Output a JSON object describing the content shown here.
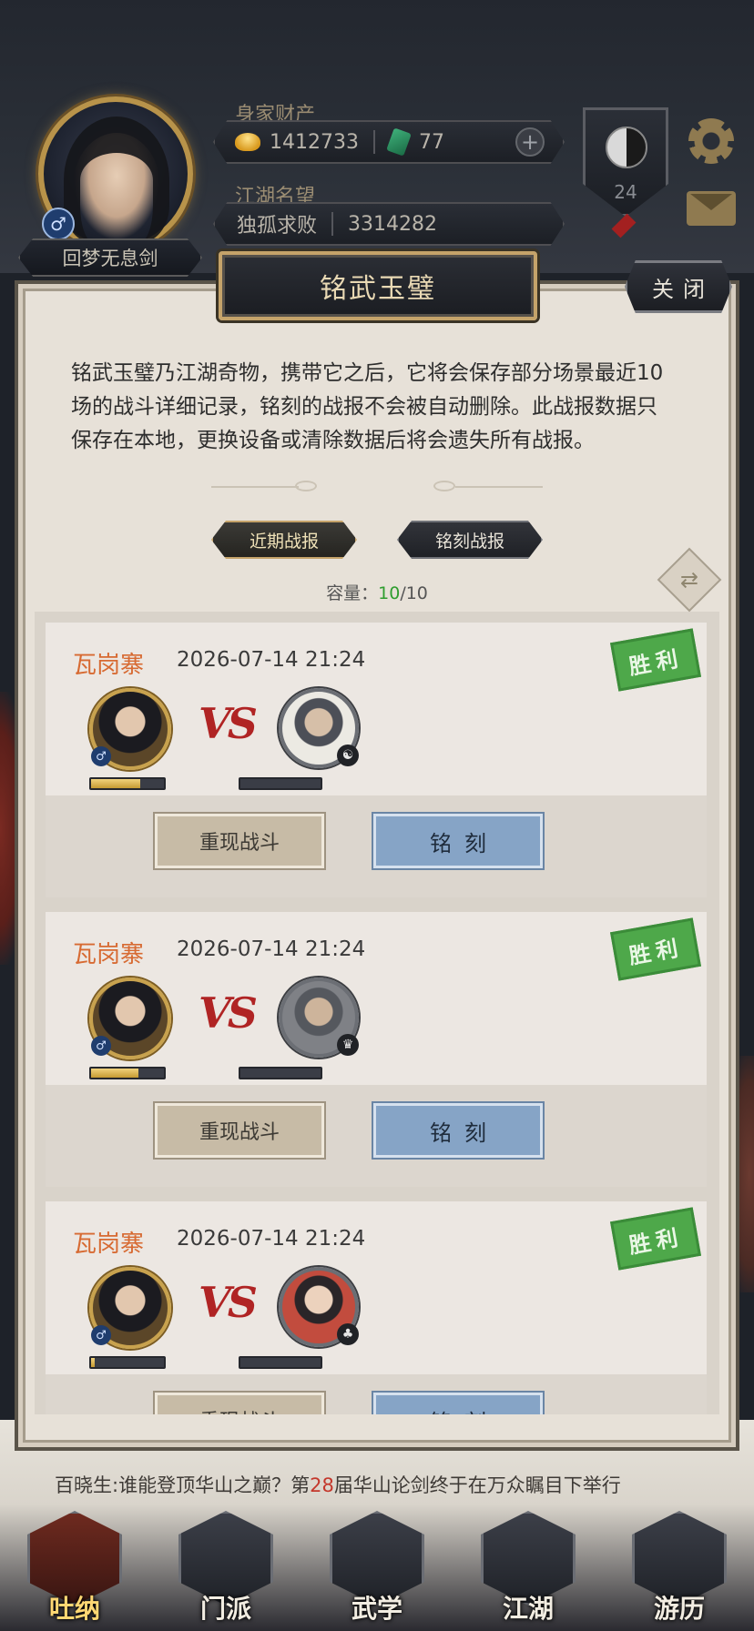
{
  "header": {
    "player_name": "回梦无息剑",
    "gender_symbol": "♂",
    "wealth_label": "身家财产",
    "gold": "1412733",
    "jade": "77",
    "plus": "+",
    "fame_label": "江湖名望",
    "fame_title": "独孤求败",
    "fame_value": "3314282",
    "level_badge": "24"
  },
  "panel": {
    "title": "铭武玉璧",
    "close_label": "关闭",
    "intro": "铭武玉璧乃江湖奇物，携带它之后，它将会保存部分场景最近10场的战斗详细记录，铭刻的战报不会被自动删除。此战报数据只保存在本地，更换设备或清除数据后将会遗失所有战报。",
    "tabs": [
      {
        "label": "近期战报",
        "active": true
      },
      {
        "label": "铭刻战报",
        "active": false
      }
    ],
    "capacity_label": "容量：",
    "capacity_used": "10",
    "capacity_total": "/10"
  },
  "records": [
    {
      "location": "瓦岗寨",
      "time": "2026-07-14 21:24",
      "result": "胜利",
      "vs": "VS",
      "player_hp_fraction": 0.68,
      "enemy_hp_fraction": 0,
      "enemy_sect_icon": "☯",
      "replay_label": "重现战斗",
      "engrave_label": "铭刻"
    },
    {
      "location": "瓦岗寨",
      "time": "2026-07-14 21:24",
      "result": "胜利",
      "vs": "VS",
      "player_hp_fraction": 0.65,
      "enemy_hp_fraction": 0,
      "enemy_sect_icon": "♛",
      "replay_label": "重现战斗",
      "engrave_label": "铭刻"
    },
    {
      "location": "瓦岗寨",
      "time": "2026-07-14 21:24",
      "result": "胜利",
      "vs": "VS",
      "player_hp_fraction": 0.05,
      "enemy_hp_fraction": 0,
      "enemy_sect_icon": "♣",
      "replay_label": "重现战斗",
      "engrave_label": "铭刻"
    }
  ],
  "marquee": {
    "prefix": "百晓生:谁能登顶华山之巅？第",
    "number": "28",
    "suffix": "届华山论剑终于在万众瞩目下举行"
  },
  "nav": [
    {
      "label": "吐纳",
      "icon": "meditation-icon",
      "active": true
    },
    {
      "label": "门派",
      "icon": "sect-icon",
      "active": false
    },
    {
      "label": "武学",
      "icon": "martial-arts-icon",
      "active": false
    },
    {
      "label": "江湖",
      "icon": "jianghu-icon",
      "active": false
    },
    {
      "label": "游历",
      "icon": "travel-icon",
      "active": false
    }
  ]
}
